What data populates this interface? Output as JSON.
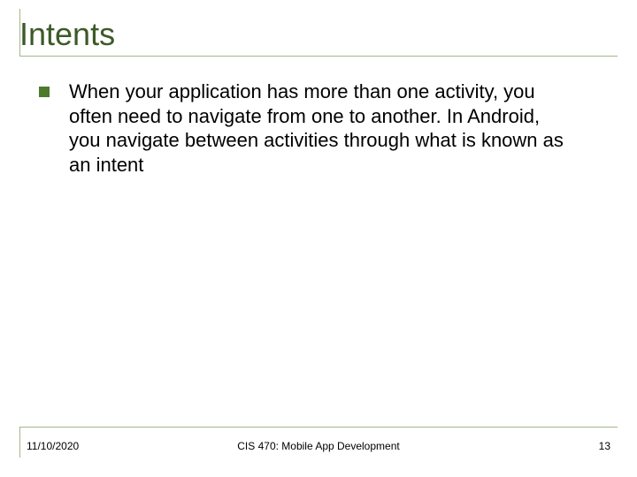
{
  "slide": {
    "title": "Intents",
    "bullets": [
      {
        "text": "When your application has more than one activity, you often need to navigate from one to another. In Android, you navigate between activities through what is known as an intent"
      }
    ],
    "footer": {
      "date": "11/10/2020",
      "center": "CIS 470: Mobile App Development",
      "page": "13"
    }
  },
  "colors": {
    "title": "#3b5a28",
    "rule": "#a3b58a",
    "bullet": "#4e7a2d"
  }
}
